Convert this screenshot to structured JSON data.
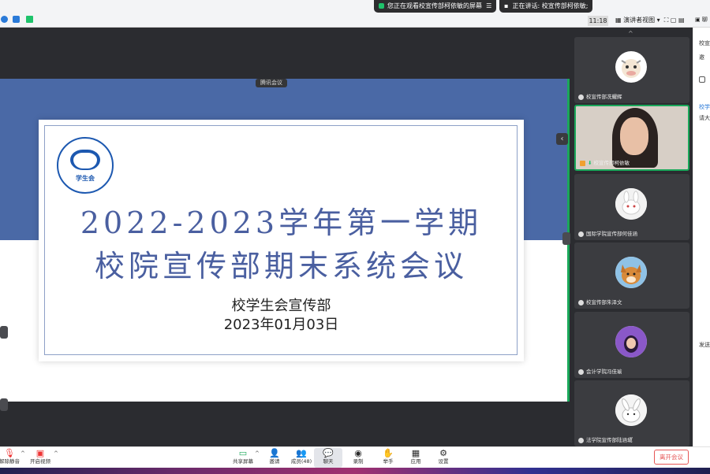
{
  "notifications": {
    "sharing": "您正在观看校宣传部柯依敏的屏幕",
    "speaking": "正在讲话: 校宣传部柯依敏;"
  },
  "top": {
    "time": "11:18",
    "view_label": "演讲者视图"
  },
  "slide": {
    "app_pill": "腾讯会议",
    "logo_text": "学生会",
    "title_line1": "2022-2023学年第一学期",
    "title_line2": "校院宣传部期末系统会议",
    "subtitle_line1": "校学生会宣传部",
    "subtitle_line2": "2023年01月03日"
  },
  "participants": [
    {
      "name": "校宣传部冼耀辉",
      "avatar": "cow-avatar"
    },
    {
      "name": "校宣传部柯依敏",
      "avatar": "camera-video"
    },
    {
      "name": "国际学院宣传部何佳涵",
      "avatar": "rabbit-avatar"
    },
    {
      "name": "校宣传部朱泽文",
      "avatar": "dog-avatar"
    },
    {
      "name": "会计学院冯佳瑜",
      "avatar": "girl-avatar"
    },
    {
      "name": "法学院宣传部陆涵城",
      "avatar": "bunny-avatar"
    }
  ],
  "chat_panel": {
    "line1": "校宣",
    "line2": "邀",
    "line3": "校学",
    "line4": "请大",
    "line5": "发送",
    "header": "聊"
  },
  "toolbar": {
    "mute": "解除静音",
    "video": "开启视频",
    "share": "共享屏幕",
    "invite": "邀请",
    "members": "成员(48)",
    "chat": "聊天",
    "record": "录制",
    "raise_hand": "举手",
    "apps": "应用",
    "settings": "设置",
    "leave": "离开会议"
  },
  "colors": {
    "slide_blue": "#4a69a6",
    "title_blue": "#4a5fa0",
    "accent_green": "#1aa85a",
    "leave_red": "#e65555"
  }
}
